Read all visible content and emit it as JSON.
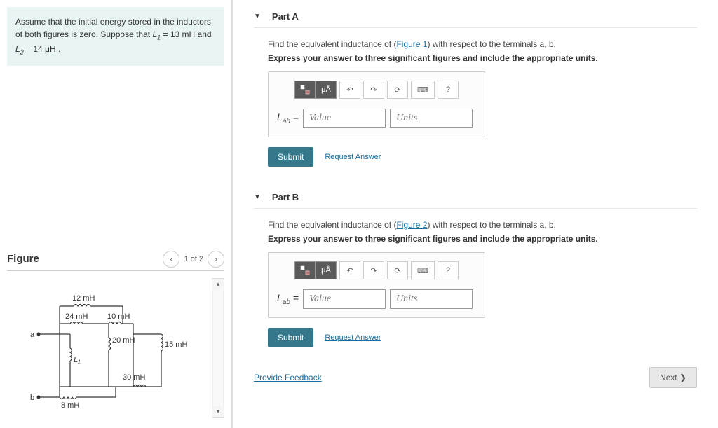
{
  "problem": {
    "text_before": "Assume that the initial energy stored in the inductors of both figures is zero. Suppose that ",
    "L1": "L",
    "L1_sub": "1",
    "L1_val": " = 13 mH",
    "and": " and ",
    "L2": "L",
    "L2_sub": "2",
    "L2_val": " = 14 μH",
    "period": " ."
  },
  "figure": {
    "title": "Figure",
    "page": "1 of 2",
    "labels": {
      "l12": "12 mH",
      "l24": "24 mH",
      "l10": "10 mH",
      "l20": "20 mH",
      "l15": "15 mH",
      "l30": "30 mH",
      "l8": "8 mH",
      "L1": "L₁",
      "a": "a",
      "b": "b"
    }
  },
  "partA": {
    "title": "Part A",
    "question_pre": "Find the equivalent inductance of (",
    "question_link": "Figure 1",
    "question_post": ") with respect to the terminals a, b.",
    "instruction": "Express your answer to three significant figures and include the appropriate units.",
    "var": "L",
    "var_sub": "ab",
    "eq": " = ",
    "value_ph": "Value",
    "units_ph": "Units",
    "submit": "Submit",
    "request": "Request Answer",
    "tool_ua": "μÅ",
    "tool_q": "?"
  },
  "partB": {
    "title": "Part B",
    "question_pre": "Find the equivalent inductance of (",
    "question_link": "Figure 2",
    "question_post": ") with respect to the terminals a, b.",
    "instruction": "Express your answer to three significant figures and include the appropriate units.",
    "var": "L",
    "var_sub": "ab",
    "eq": " = ",
    "value_ph": "Value",
    "units_ph": "Units",
    "submit": "Submit",
    "request": "Request Answer",
    "tool_ua": "μÅ",
    "tool_q": "?"
  },
  "footer": {
    "feedback": "Provide Feedback",
    "next": "Next ❯"
  }
}
